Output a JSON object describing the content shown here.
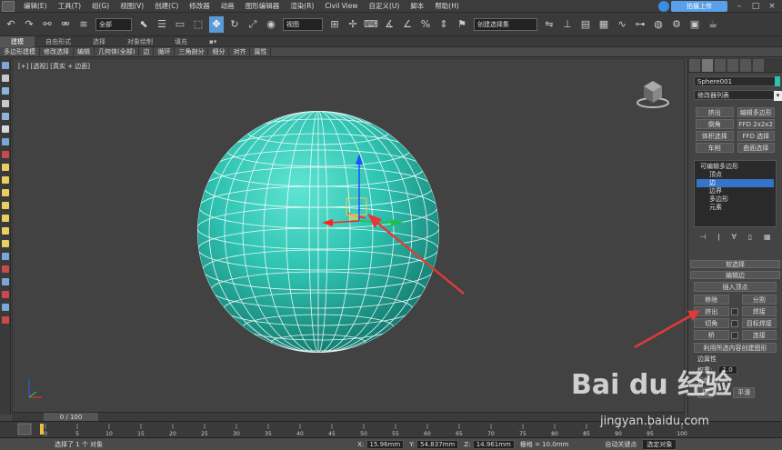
{
  "menu": {
    "items": [
      "编辑(E)",
      "工具(T)",
      "组(G)",
      "视图(V)",
      "创建(C)",
      "修改器",
      "动画",
      "图形编辑器",
      "渲染(R)",
      "Civil View",
      "自定义(U)",
      "脚本",
      "帮助(H)"
    ],
    "upload_label": "拍摄上传"
  },
  "toolbar": {
    "filter_select": "全部",
    "view_select": "视图",
    "selection_set_placeholder": "创建选择集"
  },
  "ribbon": {
    "tabs": [
      "建模",
      "自由形式",
      "选择",
      "对象绘制",
      "填充"
    ],
    "subtabs": [
      "多边形建模",
      "修改选择",
      "编辑",
      "几何体(全部)",
      "边",
      "循环",
      "三角剖分",
      "细分",
      "对齐",
      "属性"
    ]
  },
  "viewport": {
    "label": "[+] [透视] [真实 + 边面]"
  },
  "timeline": {
    "frame": "0 / 100"
  },
  "panel": {
    "object_name": "Sphere001",
    "modifier_list": "修改器列表",
    "modifier_buttons": [
      "挤出",
      "编辑多边形",
      "倒角",
      "FFD 2x2x2",
      "体积选择",
      "FFD 选择",
      "车削",
      "曲面选择"
    ],
    "stack": {
      "root": "可编辑多边形",
      "subs": [
        "顶点",
        "边",
        "边界",
        "多边形",
        "元素"
      ]
    },
    "rollouts": {
      "soft_selection": "软选择",
      "edit_edges": "编辑边",
      "insert_vertex": "插入顶点",
      "remove": "移除",
      "split": "分割",
      "extrude": "挤出",
      "weld": "焊接",
      "chamfer": "切角",
      "target_weld": "目标焊接",
      "bridge": "桥",
      "connect": "连接",
      "create_shape": "利用所选内容创建图形",
      "edge_properties": "边属性",
      "weight": "权重:",
      "weight_value": "1.0",
      "crease": "折缝:",
      "smooth": "平滑",
      "hard": "硬",
      "flatten": "平直"
    }
  },
  "status": {
    "selection": "选择了 1 个 对象",
    "x_label": "X:",
    "x_value": "15.96mm",
    "y_label": "Y:",
    "y_value": "54.837mm",
    "z_label": "Z:",
    "z_value": "14.961mm",
    "grid": "栅格 = 10.0mm",
    "autokey": "自动关键点",
    "selected_object": "选定对象"
  },
  "ruler": {
    "ticks": [
      "0",
      "5",
      "10",
      "15",
      "20",
      "25",
      "30",
      "35",
      "40",
      "45",
      "50",
      "55",
      "60",
      "65",
      "70",
      "75",
      "80",
      "85",
      "90",
      "95",
      "100"
    ]
  },
  "watermark": {
    "logo": "Bai du 经验",
    "url": "jingyan.baidu.com"
  },
  "colors": {
    "sphere": "#2ec2b0",
    "selection": "#3574c8",
    "arrow": "#e03a3a"
  }
}
